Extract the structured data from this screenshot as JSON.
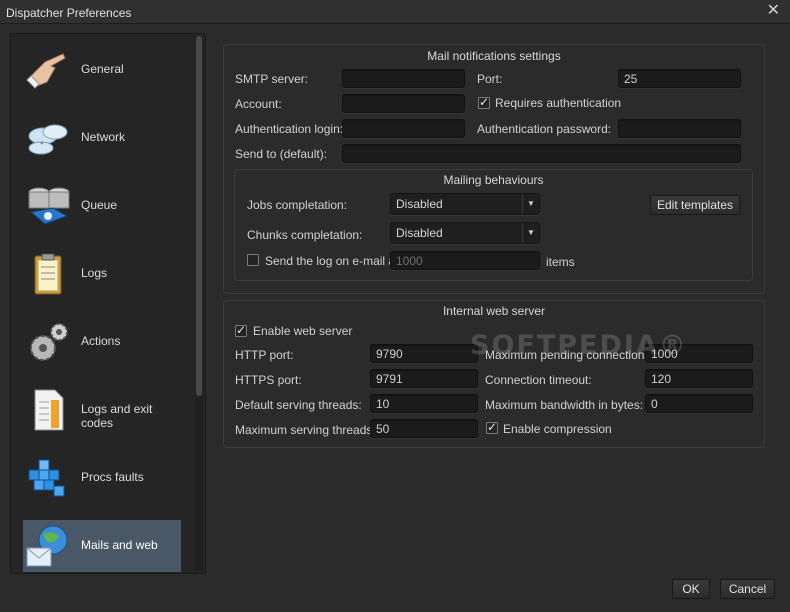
{
  "window": {
    "title": "Dispatcher Preferences",
    "close_glyph": "✕"
  },
  "sidebar": {
    "items": [
      {
        "label": "General",
        "icon": "pointing-hand-icon"
      },
      {
        "label": "Network",
        "icon": "cloud-network-icon"
      },
      {
        "label": "Queue",
        "icon": "database-queue-icon"
      },
      {
        "label": "Logs",
        "icon": "clipboard-icon"
      },
      {
        "label": "Actions",
        "icon": "gears-icon"
      },
      {
        "label": "Logs and exit codes",
        "icon": "document-list-icon"
      },
      {
        "label": "Procs faults",
        "icon": "blue-cubes-icon"
      },
      {
        "label": "Mails and web",
        "icon": "globe-mail-icon",
        "selected": true
      }
    ]
  },
  "mail": {
    "title": "Mail notifications settings",
    "smtp_label": "SMTP server:",
    "smtp_value": "",
    "port_label": "Port:",
    "port_value": "25",
    "account_label": "Account:",
    "account_value": "",
    "requires_auth_label": "Requires authentication",
    "requires_auth_checked": true,
    "auth_login_label": "Authentication login:",
    "auth_login_value": "",
    "auth_password_label": "Authentication password:",
    "auth_password_value": "",
    "sendto_label": "Send to (default):",
    "sendto_value": "",
    "behaviours": {
      "title": "Mailing behaviours",
      "jobs_label": "Jobs completation:",
      "jobs_value": "Disabled",
      "chunks_label": "Chunks completation:",
      "chunks_value": "Disabled",
      "edit_templates_label": "Edit templates",
      "sendlog_label": "Send the log on e-mail at",
      "sendlog_checked": false,
      "sendlog_value": "1000",
      "items_label": "items"
    }
  },
  "web": {
    "title": "Internal web server",
    "enable_label": "Enable web server",
    "enable_checked": true,
    "http_port_label": "HTTP port:",
    "http_port_value": "9790",
    "max_pending_label": "Maximum pending connections:",
    "max_pending_value": "1000",
    "https_port_label": "HTTPS port:",
    "https_port_value": "9791",
    "timeout_label": "Connection timeout:",
    "timeout_value": "120",
    "default_threads_label": "Default serving threads:",
    "default_threads_value": "10",
    "max_bandwidth_label": "Maximum bandwidth in bytes:",
    "max_bandwidth_value": "0",
    "max_threads_label": "Maximum serving threads:",
    "max_threads_value": "50",
    "compression_label": "Enable compression",
    "compression_checked": true
  },
  "footer": {
    "ok_label": "OK",
    "cancel_label": "Cancel"
  },
  "watermark": "SOFTPEDIA®"
}
